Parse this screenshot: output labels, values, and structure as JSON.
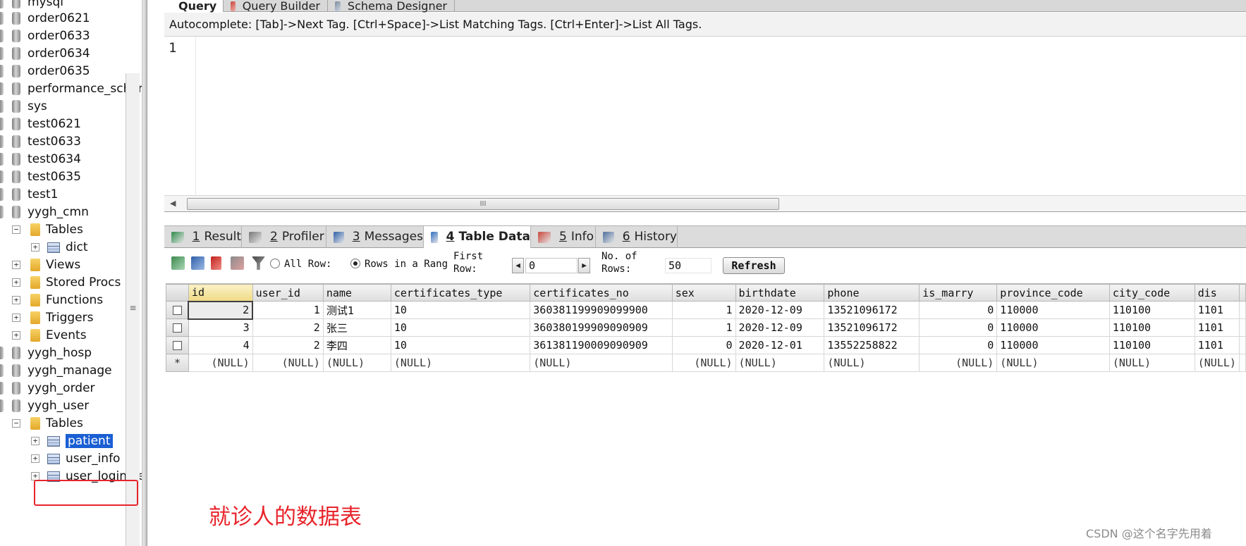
{
  "tree": {
    "items": [
      {
        "label": "mysql",
        "type": "db"
      },
      {
        "label": "order0621",
        "type": "db"
      },
      {
        "label": "order0633",
        "type": "db"
      },
      {
        "label": "order0634",
        "type": "db"
      },
      {
        "label": "order0635",
        "type": "db"
      },
      {
        "label": "performance_schem",
        "type": "db"
      },
      {
        "label": "sys",
        "type": "db"
      },
      {
        "label": "test0621",
        "type": "db"
      },
      {
        "label": "test0633",
        "type": "db"
      },
      {
        "label": "test0634",
        "type": "db"
      },
      {
        "label": "test0635",
        "type": "db"
      },
      {
        "label": "test1",
        "type": "db"
      },
      {
        "label": "yygh_cmn",
        "type": "db"
      },
      {
        "label": "Tables",
        "type": "folder"
      },
      {
        "label": "dict",
        "type": "table"
      },
      {
        "label": "Views",
        "type": "folder"
      },
      {
        "label": "Stored Procs",
        "type": "folder"
      },
      {
        "label": "Functions",
        "type": "folder"
      },
      {
        "label": "Triggers",
        "type": "folder"
      },
      {
        "label": "Events",
        "type": "folder"
      },
      {
        "label": "yygh_hosp",
        "type": "db"
      },
      {
        "label": "yygh_manage",
        "type": "db"
      },
      {
        "label": "yygh_order",
        "type": "db"
      },
      {
        "label": "yygh_user",
        "type": "db"
      },
      {
        "label": "Tables",
        "type": "folder"
      },
      {
        "label": "patient",
        "type": "table"
      },
      {
        "label": "user_info",
        "type": "table"
      },
      {
        "label": "user_login_re",
        "type": "table"
      }
    ]
  },
  "top_tabs": [
    {
      "label": "Query",
      "active": true
    },
    {
      "label": "Query Builder",
      "active": false
    },
    {
      "label": "Schema Designer",
      "active": false
    }
  ],
  "autocomplete_hint": "Autocomplete: [Tab]->Next Tag. [Ctrl+Space]->List Matching Tags. [Ctrl+Enter]->List All Tags.",
  "editor": {
    "line_number": "1",
    "scroll_grip": "III"
  },
  "result_tabs": [
    {
      "num": "1",
      "label": "Result",
      "active": false
    },
    {
      "num": "2",
      "label": "Profiler",
      "active": false
    },
    {
      "num": "3",
      "label": "Messages",
      "active": false
    },
    {
      "num": "4",
      "label": "Table Data",
      "active": true
    },
    {
      "num": "5",
      "label": "Info",
      "active": false
    },
    {
      "num": "6",
      "label": "History",
      "active": false
    }
  ],
  "toolbar": {
    "all_rows_label": "All Row:",
    "rows_in_range_label": "Rows in a Rang",
    "first_row_label_1": "First",
    "first_row_label_2": "Row:",
    "first_row_value": "0",
    "no_of_rows_label_1": "No. of",
    "no_of_rows_label_2": "Rows:",
    "no_of_rows_value": "50",
    "refresh_label": "Refresh"
  },
  "grid": {
    "columns": [
      "id",
      "user_id",
      "name",
      "certificates_type",
      "certificates_no",
      "sex",
      "birthdate",
      "phone",
      "is_marry",
      "province_code",
      "city_code",
      "dis"
    ],
    "rows": [
      [
        "2",
        "1",
        "测试1",
        "10",
        "360381199909099900",
        "1",
        "2020-12-09",
        "13521096172",
        "0",
        "110000",
        "110100",
        "1101"
      ],
      [
        "3",
        "2",
        "张三",
        "10",
        "360380199909090909",
        "1",
        "2020-12-09",
        "13521096172",
        "0",
        "110000",
        "110100",
        "1101"
      ],
      [
        "4",
        "2",
        "李四",
        "10",
        "361381190009090909",
        "0",
        "2020-12-01",
        "13552258822",
        "0",
        "110000",
        "110100",
        "1101"
      ]
    ],
    "new_row_marker": "*",
    "null_text": "(NULL)"
  },
  "annotation": "就诊人的数据表",
  "watermark": "CSDN @这个名字先用着",
  "colors": {
    "annotation_red": "#e8242b",
    "selection_blue": "#1a5fd3",
    "sort_header": "#efd985"
  }
}
